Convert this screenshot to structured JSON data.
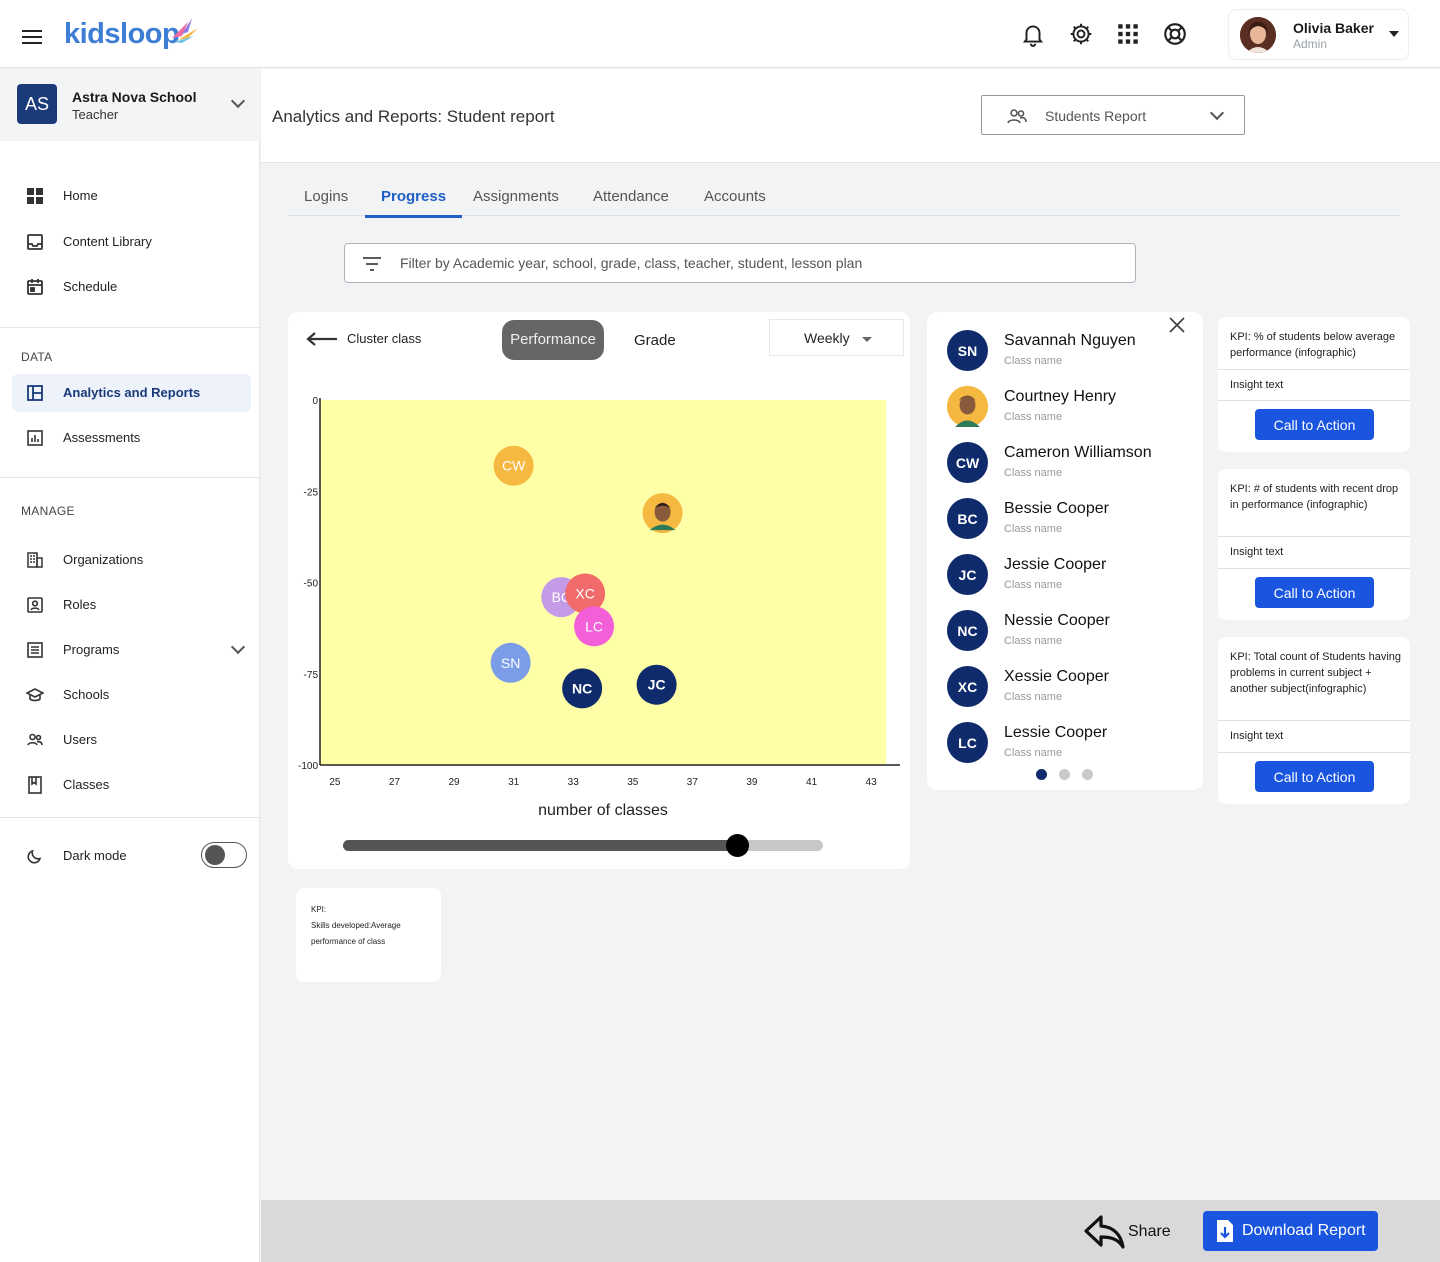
{
  "app": {
    "brand": "kidsloop"
  },
  "user": {
    "name": "Olivia Baker",
    "role": "Admin"
  },
  "sidebar": {
    "org": {
      "initials": "AS",
      "name": "Astra Nova School",
      "role": "Teacher"
    },
    "main_items": [
      {
        "label": "Home",
        "icon": "home-grid-icon"
      },
      {
        "label": "Content Library",
        "icon": "inbox-icon"
      },
      {
        "label": "Schedule",
        "icon": "calendar-icon"
      }
    ],
    "data_section": "DATA",
    "data_items": [
      {
        "label": "Analytics and Reports",
        "icon": "dashboard-icon",
        "active": true
      },
      {
        "label": "Assessments",
        "icon": "bar-chart-icon"
      }
    ],
    "manage_section": "MANAGE",
    "manage_items": [
      {
        "label": "Organizations",
        "icon": "building-icon"
      },
      {
        "label": "Roles",
        "icon": "badge-icon"
      },
      {
        "label": "Programs",
        "icon": "list-icon"
      },
      {
        "label": "Schools",
        "icon": "school-icon"
      },
      {
        "label": "Users",
        "icon": "users-icon"
      },
      {
        "label": "Classes",
        "icon": "book-icon"
      }
    ],
    "dark_mode": {
      "label": "Dark mode",
      "enabled": false
    }
  },
  "header": {
    "title": "Analytics and Reports: Student report",
    "report_select": "Students Report"
  },
  "tabs": [
    {
      "label": "Logins",
      "active": false
    },
    {
      "label": "Progress",
      "active": true
    },
    {
      "label": "Assignments",
      "active": false
    },
    {
      "label": "Attendance",
      "active": false
    },
    {
      "label": "Accounts",
      "active": false
    }
  ],
  "filter": {
    "placeholder": "Filter by Academic year, school, grade, class, teacher, student, lesson plan"
  },
  "chart_panel": {
    "back_label": "Cluster class",
    "performance_label": "Performance",
    "grade_label": "Grade",
    "period": "Weekly",
    "slider_value": 0.82
  },
  "chart_data": {
    "type": "scatter",
    "xlabel": "number of classes",
    "ylabel": "",
    "x_ticks": [
      25,
      27,
      29,
      31,
      33,
      35,
      37,
      39,
      41,
      43
    ],
    "y_ticks": [
      0,
      -25,
      -50,
      -75,
      -100
    ],
    "xlim": [
      24.5,
      43.5
    ],
    "ylim": [
      -100,
      0
    ],
    "plot_background": "#ffffa8",
    "points": [
      {
        "label": "CW",
        "x": 31,
        "y": -18,
        "color": "#f5b942"
      },
      {
        "label": "",
        "x": 36,
        "y": -31,
        "color": "#f5b942",
        "photo": true
      },
      {
        "label": "BC",
        "x": 32.6,
        "y": -54,
        "color": "#c39be6"
      },
      {
        "label": "XC",
        "x": 33.4,
        "y": -53,
        "color": "#f26b6b"
      },
      {
        "label": "LC",
        "x": 33.7,
        "y": -62,
        "color": "#f25fd8"
      },
      {
        "label": "SN",
        "x": 30.9,
        "y": -72,
        "color": "#7b9de8"
      },
      {
        "label": "NC",
        "x": 33.3,
        "y": -79,
        "color": "#0f2b6b"
      },
      {
        "label": "JC",
        "x": 35.8,
        "y": -78,
        "color": "#0f2b6b"
      }
    ]
  },
  "students": [
    {
      "initials": "SN",
      "name": "Savannah Nguyen",
      "class": "Class name"
    },
    {
      "initials": "",
      "name": "Courtney Henry",
      "class": "Class name",
      "photo": true
    },
    {
      "initials": "CW",
      "name": "Cameron Williamson",
      "class": "Class name"
    },
    {
      "initials": "BC",
      "name": "Bessie Cooper",
      "class": "Class name"
    },
    {
      "initials": "JC",
      "name": "Jessie Cooper",
      "class": "Class name"
    },
    {
      "initials": "NC",
      "name": "Nessie Cooper",
      "class": "Class name"
    },
    {
      "initials": "XC",
      "name": "Xessie Cooper",
      "class": "Class name"
    },
    {
      "initials": "LC",
      "name": "Lessie Cooper",
      "class": "Class name"
    }
  ],
  "kpis": [
    {
      "title": "KPI: % of students below average performance (infographic)",
      "insight": "Insight text",
      "cta": "Call to Action"
    },
    {
      "title": "KPI: # of students with recent drop in performance (infographic)",
      "insight": "Insight text",
      "cta": "Call to Action"
    },
    {
      "title": "KPI: Total count of Students having problems in current subject + another subject(infographic)",
      "insight": "Insight text",
      "cta": "Call to Action"
    }
  ],
  "mini_kpi": {
    "line1": "KPI:",
    "line2": "Skills developed:Average",
    "line3": "performance of class"
  },
  "footer": {
    "share": "Share",
    "download": "Download Report"
  },
  "colors": {
    "brand_blue": "#3d7ed4",
    "primary": "#1a55e0",
    "navy": "#0f2b6b",
    "tab_active": "#1f5fc6"
  }
}
